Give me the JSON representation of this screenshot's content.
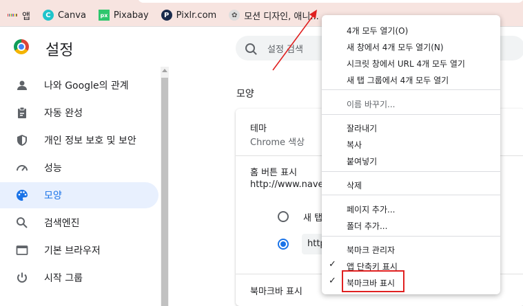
{
  "bookmarks_bar": [
    {
      "label": "앱",
      "icon": "apps-grid-icon"
    },
    {
      "label": "Canva",
      "icon": "canva-icon",
      "color": "#20c4cb"
    },
    {
      "label": "Pixabay",
      "icon": "pixabay-icon",
      "color": "#2ec66d"
    },
    {
      "label": "Pixlr.com",
      "icon": "pixlr-icon",
      "color": "#1a2b4c"
    },
    {
      "label": "모션 디자인, 애니...",
      "icon": "motion-design-icon"
    }
  ],
  "header": {
    "title": "설정",
    "search_placeholder": "설정 검색"
  },
  "sidebar": {
    "items": [
      {
        "label": "나와 Google의 관계",
        "icon": "person-icon"
      },
      {
        "label": "자동 완성",
        "icon": "clipboard-icon"
      },
      {
        "label": "개인 정보 보호 및 보안",
        "icon": "shield-icon"
      },
      {
        "label": "성능",
        "icon": "speedometer-icon"
      },
      {
        "label": "모양",
        "icon": "palette-icon",
        "active": true
      },
      {
        "label": "검색엔진",
        "icon": "search-icon"
      },
      {
        "label": "기본 브라우저",
        "icon": "browser-window-icon"
      },
      {
        "label": "시작 그룹",
        "icon": "power-icon"
      }
    ]
  },
  "main": {
    "section_title": "모양",
    "theme_label": "테마",
    "theme_value": "Chrome 색상",
    "home_button_label": "홈 버튼 표시",
    "home_button_url": "http://www.naver.c",
    "radio_new_tab_label": "새 탭",
    "url_input_value": "http",
    "bookmark_bar_label": "북마크바 표시"
  },
  "context_menu": {
    "group1": [
      "4개 모두 열기(O)",
      "새 창에서 4개 모두 열기(N)",
      "시크릿 창에서 URL 4개 모두 열기",
      "새 탭 그룹에서 4개 모두 열기"
    ],
    "group2": [
      "이름 바꾸기..."
    ],
    "group3": [
      "잘라내기",
      "복사",
      "붙여넣기"
    ],
    "group4": [
      "삭제"
    ],
    "group5": [
      "페이지 추가...",
      "폴더 추가..."
    ],
    "group6": [
      "북마크 관리자",
      "앱 단축키 표시",
      "북마크바 표시"
    ]
  },
  "colors": {
    "accent": "#1a73e8",
    "bookmark_bar_bg": "#f7e4e0",
    "highlight_red": "#e02020"
  }
}
